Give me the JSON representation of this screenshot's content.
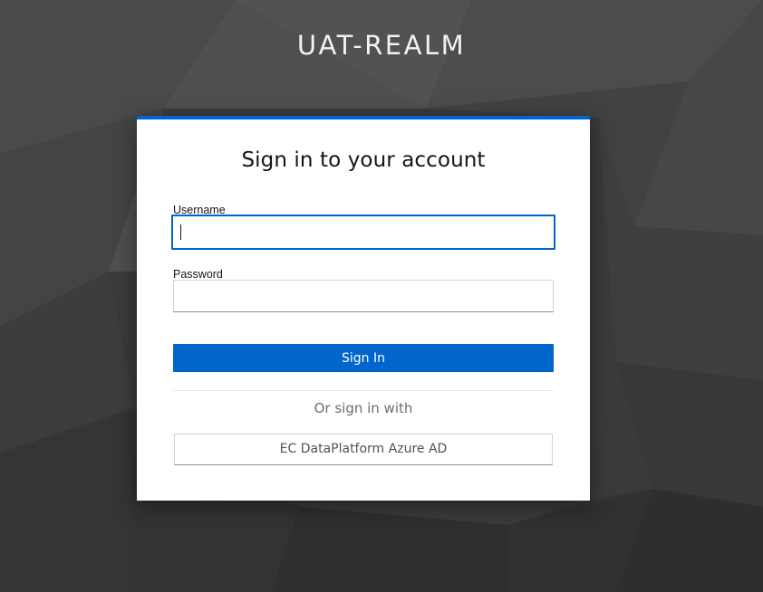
{
  "realm": {
    "title": "UAT-REALM"
  },
  "login": {
    "heading": "Sign in to your account",
    "username": {
      "label": "Username",
      "value": "",
      "placeholder": ""
    },
    "password": {
      "label": "Password",
      "value": "",
      "placeholder": ""
    },
    "submit_label": "Sign In",
    "alt_signin_text": "Or sign in with",
    "providers": [
      {
        "label": "EC DataPlatform Azure AD"
      }
    ]
  },
  "colors": {
    "accent": "#0066cc",
    "background": "#3b3b3b",
    "card": "#ffffff"
  }
}
